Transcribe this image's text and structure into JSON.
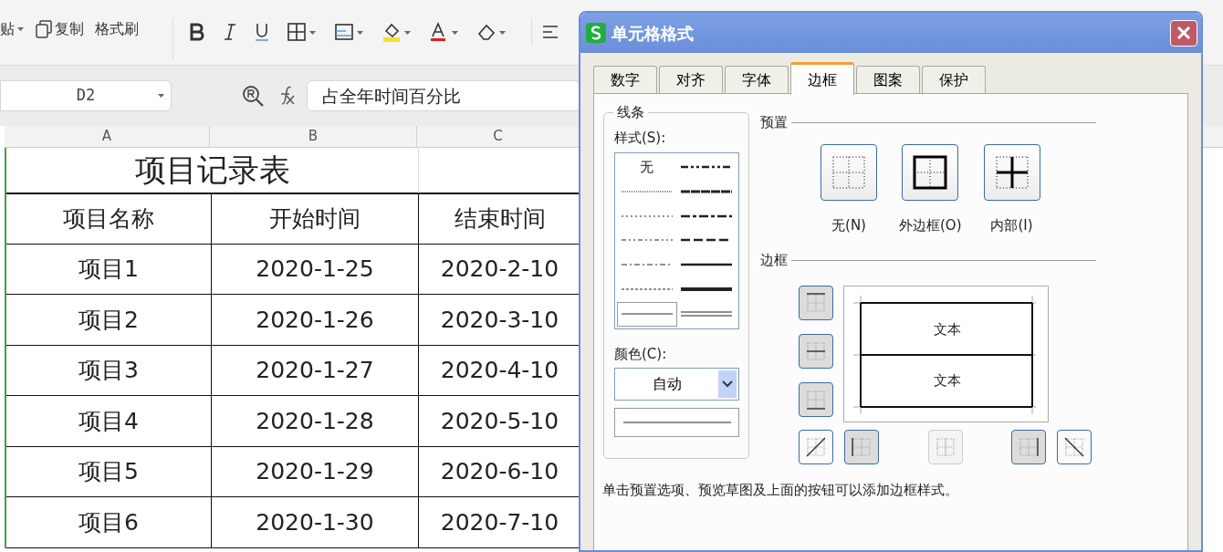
{
  "ribbon": {
    "paste_label": "贴",
    "copy_label": "复制",
    "format_painter_label": "格式刷"
  },
  "formula_bar": {
    "cell_ref": "D2",
    "formula": "占全年时间百分比"
  },
  "sheet": {
    "columns": [
      "A",
      "B",
      "C"
    ],
    "title": "项目记录表",
    "headers": [
      "项目名称",
      "开始时间",
      "结束时间"
    ],
    "rows": [
      [
        "项目1",
        "2020-1-25",
        "2020-2-10"
      ],
      [
        "项目2",
        "2020-1-26",
        "2020-3-10"
      ],
      [
        "项目3",
        "2020-1-27",
        "2020-4-10"
      ],
      [
        "项目4",
        "2020-1-28",
        "2020-5-10"
      ],
      [
        "项目5",
        "2020-1-29",
        "2020-6-10"
      ],
      [
        "项目6",
        "2020-1-30",
        "2020-7-10"
      ]
    ]
  },
  "dialog": {
    "title": "单元格格式",
    "tabs": [
      {
        "label": "数字",
        "selected": false
      },
      {
        "label": "对齐",
        "selected": false
      },
      {
        "label": "字体",
        "selected": false
      },
      {
        "label": "边框",
        "selected": true
      },
      {
        "label": "图案",
        "selected": false
      },
      {
        "label": "保护",
        "selected": false
      }
    ],
    "line_group": "线条",
    "style_label": "样式(S):",
    "line_styles": [
      {
        "kind": "none",
        "label": "无",
        "selected": false
      },
      {
        "kind": "dashdotdot-medium",
        "selected": false
      },
      {
        "kind": "hair",
        "selected": false
      },
      {
        "kind": "slanted",
        "selected": false
      },
      {
        "kind": "dotted",
        "selected": false
      },
      {
        "kind": "dashdot-medium",
        "selected": false
      },
      {
        "kind": "dashdotdot",
        "selected": false
      },
      {
        "kind": "dashed-medium",
        "selected": false
      },
      {
        "kind": "dashdot",
        "selected": false
      },
      {
        "kind": "medium",
        "selected": false
      },
      {
        "kind": "dashed",
        "selected": false
      },
      {
        "kind": "thick",
        "selected": false
      },
      {
        "kind": "thin",
        "selected": true
      },
      {
        "kind": "double",
        "selected": false
      }
    ],
    "color_label": "颜色(C):",
    "color_value": "自动",
    "preset_label": "预置",
    "presets": [
      {
        "kind": "none",
        "label": "无(N)"
      },
      {
        "kind": "outline",
        "label": "外边框(O)"
      },
      {
        "kind": "inside",
        "label": "内部(I)"
      }
    ],
    "border_label": "边框",
    "preview_texts": [
      "文本",
      "文本"
    ],
    "border_buttons": [
      {
        "kind": "top",
        "on": true,
        "disabled": false
      },
      {
        "kind": "middle",
        "on": true,
        "disabled": false
      },
      {
        "kind": "bottom",
        "on": true,
        "disabled": false
      },
      {
        "kind": "diag-up",
        "on": false,
        "disabled": false
      },
      {
        "kind": "left",
        "on": true,
        "disabled": false
      },
      {
        "kind": "center",
        "on": false,
        "disabled": true
      },
      {
        "kind": "right",
        "on": true,
        "disabled": false
      },
      {
        "kind": "diag-down",
        "on": false,
        "disabled": false
      }
    ],
    "hint": "单击预置选项、预览草图及上面的按钮可以添加边框样式。"
  }
}
